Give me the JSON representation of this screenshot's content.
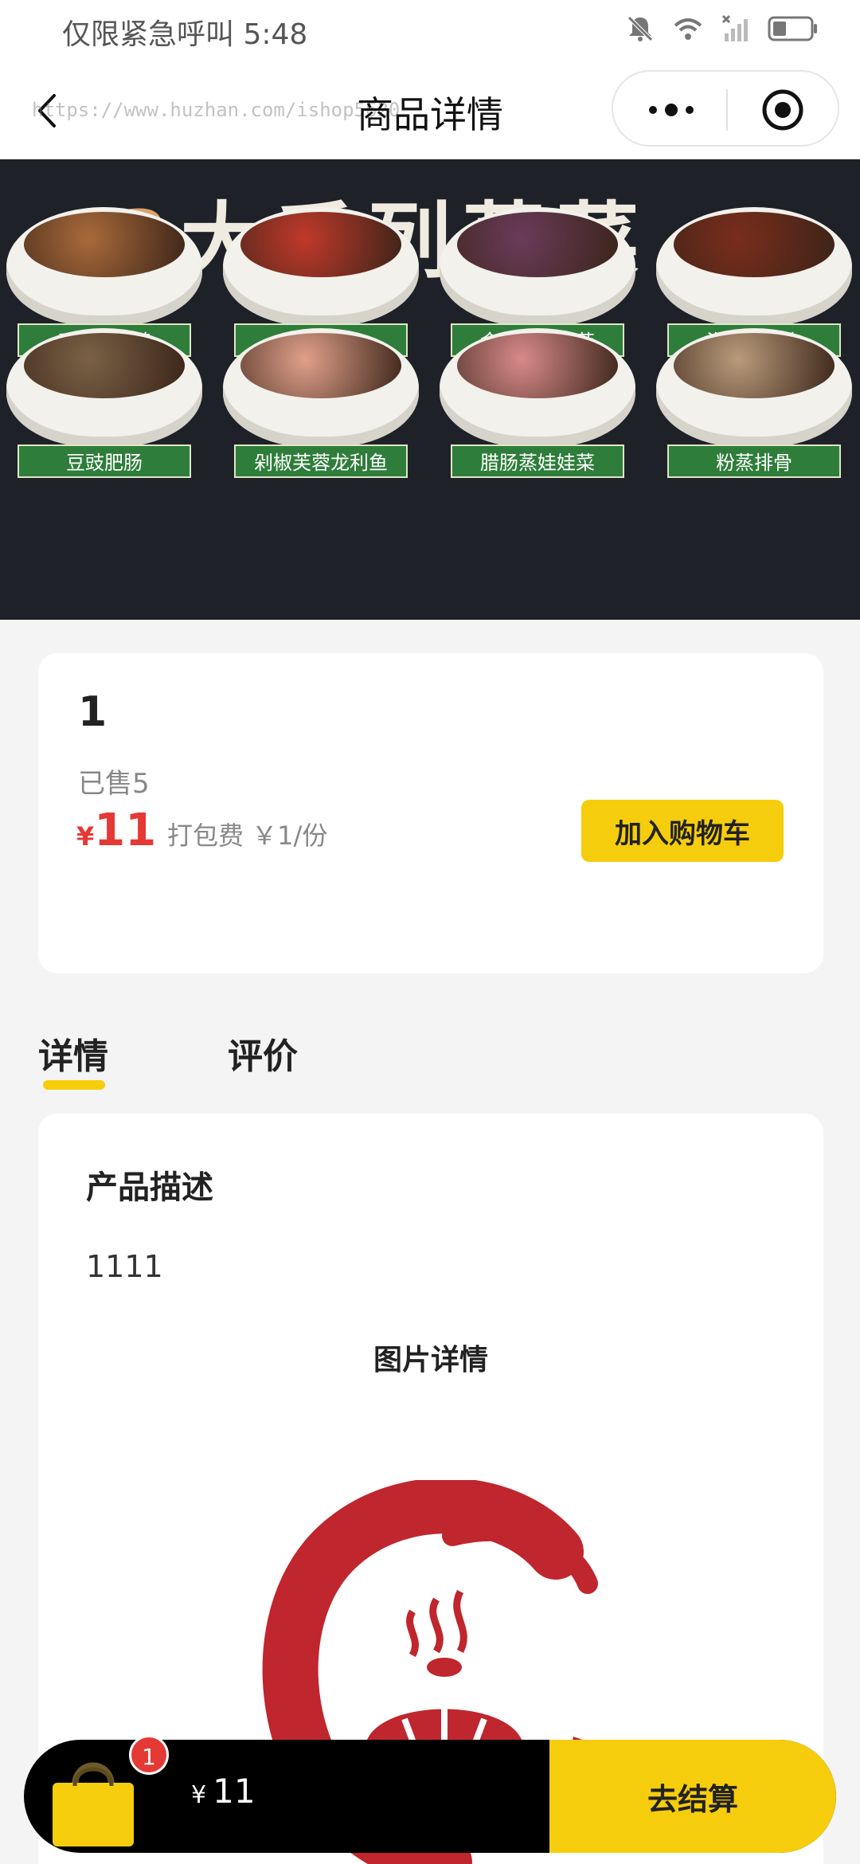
{
  "status_bar": {
    "carrier_text": "仅限紧急呼叫",
    "time": "5:48",
    "icons": [
      "bell-muted-icon",
      "wifi-icon",
      "signal-off-icon",
      "battery-icon"
    ]
  },
  "nav": {
    "title": "商品详情",
    "watermark": "https://www.huzhan.com/ishop5620",
    "icons": [
      "back-icon",
      "more-icon",
      "target-icon"
    ]
  },
  "banner": {
    "title_num": "3",
    "title_text": "大系列蒸菜",
    "dishes": [
      {
        "label": "香菇蒸滑鸡",
        "food_color": "#a96a3a"
      },
      {
        "label": "腊味合蒸",
        "food_color": "#c0392b"
      },
      {
        "label": "金银蒜蒸靓茄",
        "food_color": "#6b3b5a"
      },
      {
        "label": "泡椒蒸牛肉",
        "food_color": "#7a2d1c"
      },
      {
        "label": "豆豉肥肠",
        "food_color": "#7a6146"
      },
      {
        "label": "剁椒芙蓉龙利鱼",
        "food_color": "#e0a08a"
      },
      {
        "label": "腊肠蒸娃娃菜",
        "food_color": "#d88a8a"
      },
      {
        "label": "粉蒸排骨",
        "food_color": "#b99b7b"
      }
    ]
  },
  "product": {
    "name": "1",
    "sold": "已售5",
    "currency": "¥",
    "price": "11",
    "pack_fee": "打包费 ￥1/份",
    "add_cart_label": "加入购物车"
  },
  "tabs": [
    {
      "label": "详情",
      "active": true
    },
    {
      "label": "评价",
      "active": false
    }
  ],
  "detail": {
    "heading": "产品描述",
    "description": "1111",
    "image_heading": "图片详情"
  },
  "cart_bar": {
    "badge_count": "1",
    "currency": "¥",
    "total": "11",
    "checkout_label": "去结算"
  },
  "colors": {
    "accent": "#f6cd0c",
    "price_red": "#e53935",
    "logo_red": "#c0262d"
  }
}
